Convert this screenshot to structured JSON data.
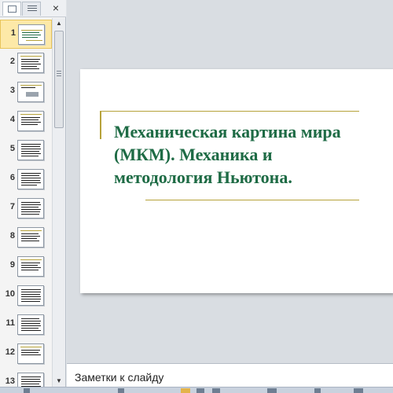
{
  "thumbnail_pane": {
    "close_glyph": "×",
    "selected_slide": 1,
    "slide_numbers": [
      "1",
      "2",
      "3",
      "4",
      "5",
      "6",
      "7",
      "8",
      "9",
      "10",
      "11",
      "12",
      "13"
    ]
  },
  "slide": {
    "title": "Механическая картина мира (МКМ). Механика и методология Ньютона.",
    "title_color": "#1e6b45",
    "accent_line_color": "#b6a23a"
  },
  "notes": {
    "placeholder": "Заметки к слайду"
  }
}
